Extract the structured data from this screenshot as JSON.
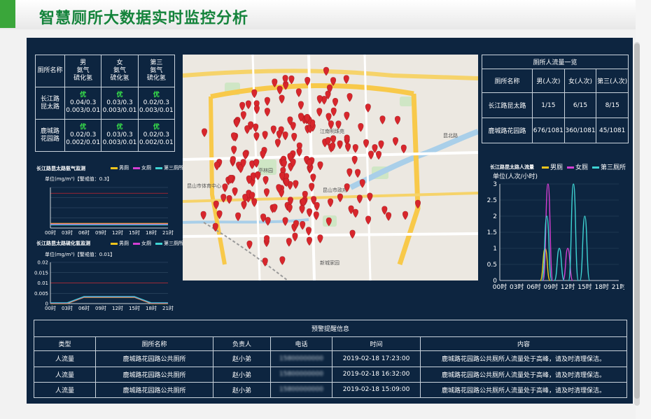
{
  "header": {
    "title": "智慧厕所大数据实时监控分析"
  },
  "colors": {
    "male": "#f0c41c",
    "female": "#d53fd3",
    "third": "#3ed3d3",
    "panel": "#0d2540",
    "ok": "#39e64a",
    "pin": "#d8262c"
  },
  "gas_table": {
    "headers": [
      "厕所名称",
      "男\n氨气\n硫化氢",
      "女\n氨气\n硫化氢",
      "第三\n氨气\n硫化氢"
    ],
    "rows": [
      {
        "name": "长江路\n昆太路",
        "cells": [
          {
            "status": "优",
            "nh3": "0.04/0.3",
            "h2s": "0.003/0.01"
          },
          {
            "status": "优",
            "nh3": "0.03/0.3",
            "h2s": "0.003/0.01"
          },
          {
            "status": "优",
            "nh3": "0.02/0.3",
            "h2s": "0.003/0.01"
          }
        ]
      },
      {
        "name": "鹿城路\n花园路",
        "cells": [
          {
            "status": "优",
            "nh3": "0.02/0.3",
            "h2s": "0.002/0.01"
          },
          {
            "status": "优",
            "nh3": "0.03/0.3",
            "h2s": "0.003/0.01"
          },
          {
            "status": "优",
            "nh3": "0.02/0.3",
            "h2s": "0.002/0.01"
          }
        ]
      }
    ]
  },
  "flow_table": {
    "caption": "厕所人流量一览",
    "headers": [
      "厕所名称",
      "男(人次)",
      "女(人次)",
      "第三(人次)"
    ],
    "rows": [
      [
        "长江路昆太路",
        "1/15",
        "6/15",
        "8/15"
      ],
      [
        "鹿城路花园路",
        "676/1081",
        "360/1081",
        "45/1081"
      ]
    ]
  },
  "legend": {
    "male": "男厕",
    "female": "女厕",
    "third": "第三厕所"
  },
  "chart_data": [
    {
      "type": "line",
      "title": "长江路昆太路氨气监测",
      "unit_label": "单位(mg/m³)【警戒值：0.3】",
      "x": [
        "00时",
        "03时",
        "06时",
        "09时",
        "12时",
        "15时",
        "18时",
        "21时"
      ],
      "threshold": 0.3,
      "series": [
        {
          "name": "男厕",
          "values": [
            0.04,
            0.04,
            0.04,
            0.04,
            0.04,
            0.04,
            0.04,
            0.04
          ]
        },
        {
          "name": "女厕",
          "values": [
            0.03,
            0.03,
            0.03,
            0.03,
            0.03,
            0.03,
            0.03,
            0.03
          ]
        },
        {
          "name": "第三厕所",
          "values": [
            0.02,
            0.02,
            0.02,
            0.02,
            0.02,
            0.02,
            0.02,
            0.02
          ]
        }
      ]
    },
    {
      "type": "line",
      "title": "长江路昆太路硫化氢监测",
      "unit_label": "单位(mg/m³)【警戒值：0.01】",
      "x": [
        "00时",
        "03时",
        "06时",
        "09时",
        "12时",
        "15时",
        "18时",
        "21时"
      ],
      "y_ticks": [
        "0.02",
        "0.015",
        "0.01",
        "0.005",
        "0"
      ],
      "ylim": [
        0,
        0.02
      ],
      "threshold": 0.01,
      "series": [
        {
          "name": "男厕",
          "values": [
            0,
            0,
            0.003,
            0.003,
            0.003,
            0.003,
            0,
            0
          ]
        },
        {
          "name": "女厕",
          "values": [
            0,
            0,
            0.003,
            0.003,
            0.003,
            0.003,
            0,
            0
          ]
        },
        {
          "name": "第三厕所",
          "values": [
            0,
            0,
            0.003,
            0.003,
            0.003,
            0.003,
            0,
            0
          ]
        }
      ]
    },
    {
      "type": "line",
      "title": "长江路昆太路人流量",
      "unit_label": "单位(人次/小时)",
      "x": [
        "00时",
        "03时",
        "06时",
        "09时",
        "12时",
        "15时",
        "18时",
        "21时"
      ],
      "y_ticks": [
        "3",
        "2.5",
        "2",
        "1.5",
        "1",
        "0.5",
        "0"
      ],
      "ylim": [
        0,
        3
      ],
      "series": [
        {
          "name": "男厕",
          "peaks": [
            [
              8,
              1
            ],
            [
              12,
              0
            ]
          ]
        },
        {
          "name": "女厕",
          "peaks": [
            [
              8.5,
              3
            ],
            [
              12,
              1
            ]
          ]
        },
        {
          "name": "第三厕所",
          "peaks": [
            [
              8.3,
              2
            ],
            [
              10.5,
              1
            ],
            [
              13,
              3
            ],
            [
              15,
              2
            ]
          ]
        }
      ]
    }
  ],
  "map": {
    "labels": [
      "昆山市政府",
      "亭林园",
      "昆山市体育中心",
      "江南明珠苑",
      "新城家园",
      "昆北路"
    ]
  },
  "alerts": {
    "caption": "预警提醒信息",
    "headers": [
      "类型",
      "厕所名称",
      "负责人",
      "电话",
      "时间",
      "内容"
    ],
    "rows": [
      [
        "人流量",
        "鹿城路花园路公共厕所",
        "赵小弟",
        "15800000000",
        "2019-02-18 17:23:00",
        "鹿城路花园路公共厕所人流量处于高峰，请及时清理保洁。"
      ],
      [
        "人流量",
        "鹿城路花园路公共厕所",
        "赵小弟",
        "15800000000",
        "2019-02-18 16:32:00",
        "鹿城路花园路公共厕所人流量处于高峰，请及时清理保洁。"
      ],
      [
        "人流量",
        "鹿城路花园路公共厕所",
        "赵小弟",
        "15800000000",
        "2019-02-18 15:09:00",
        "鹿城路花园路公共厕所人流量处于高峰，请及时清理保洁。"
      ]
    ]
  }
}
